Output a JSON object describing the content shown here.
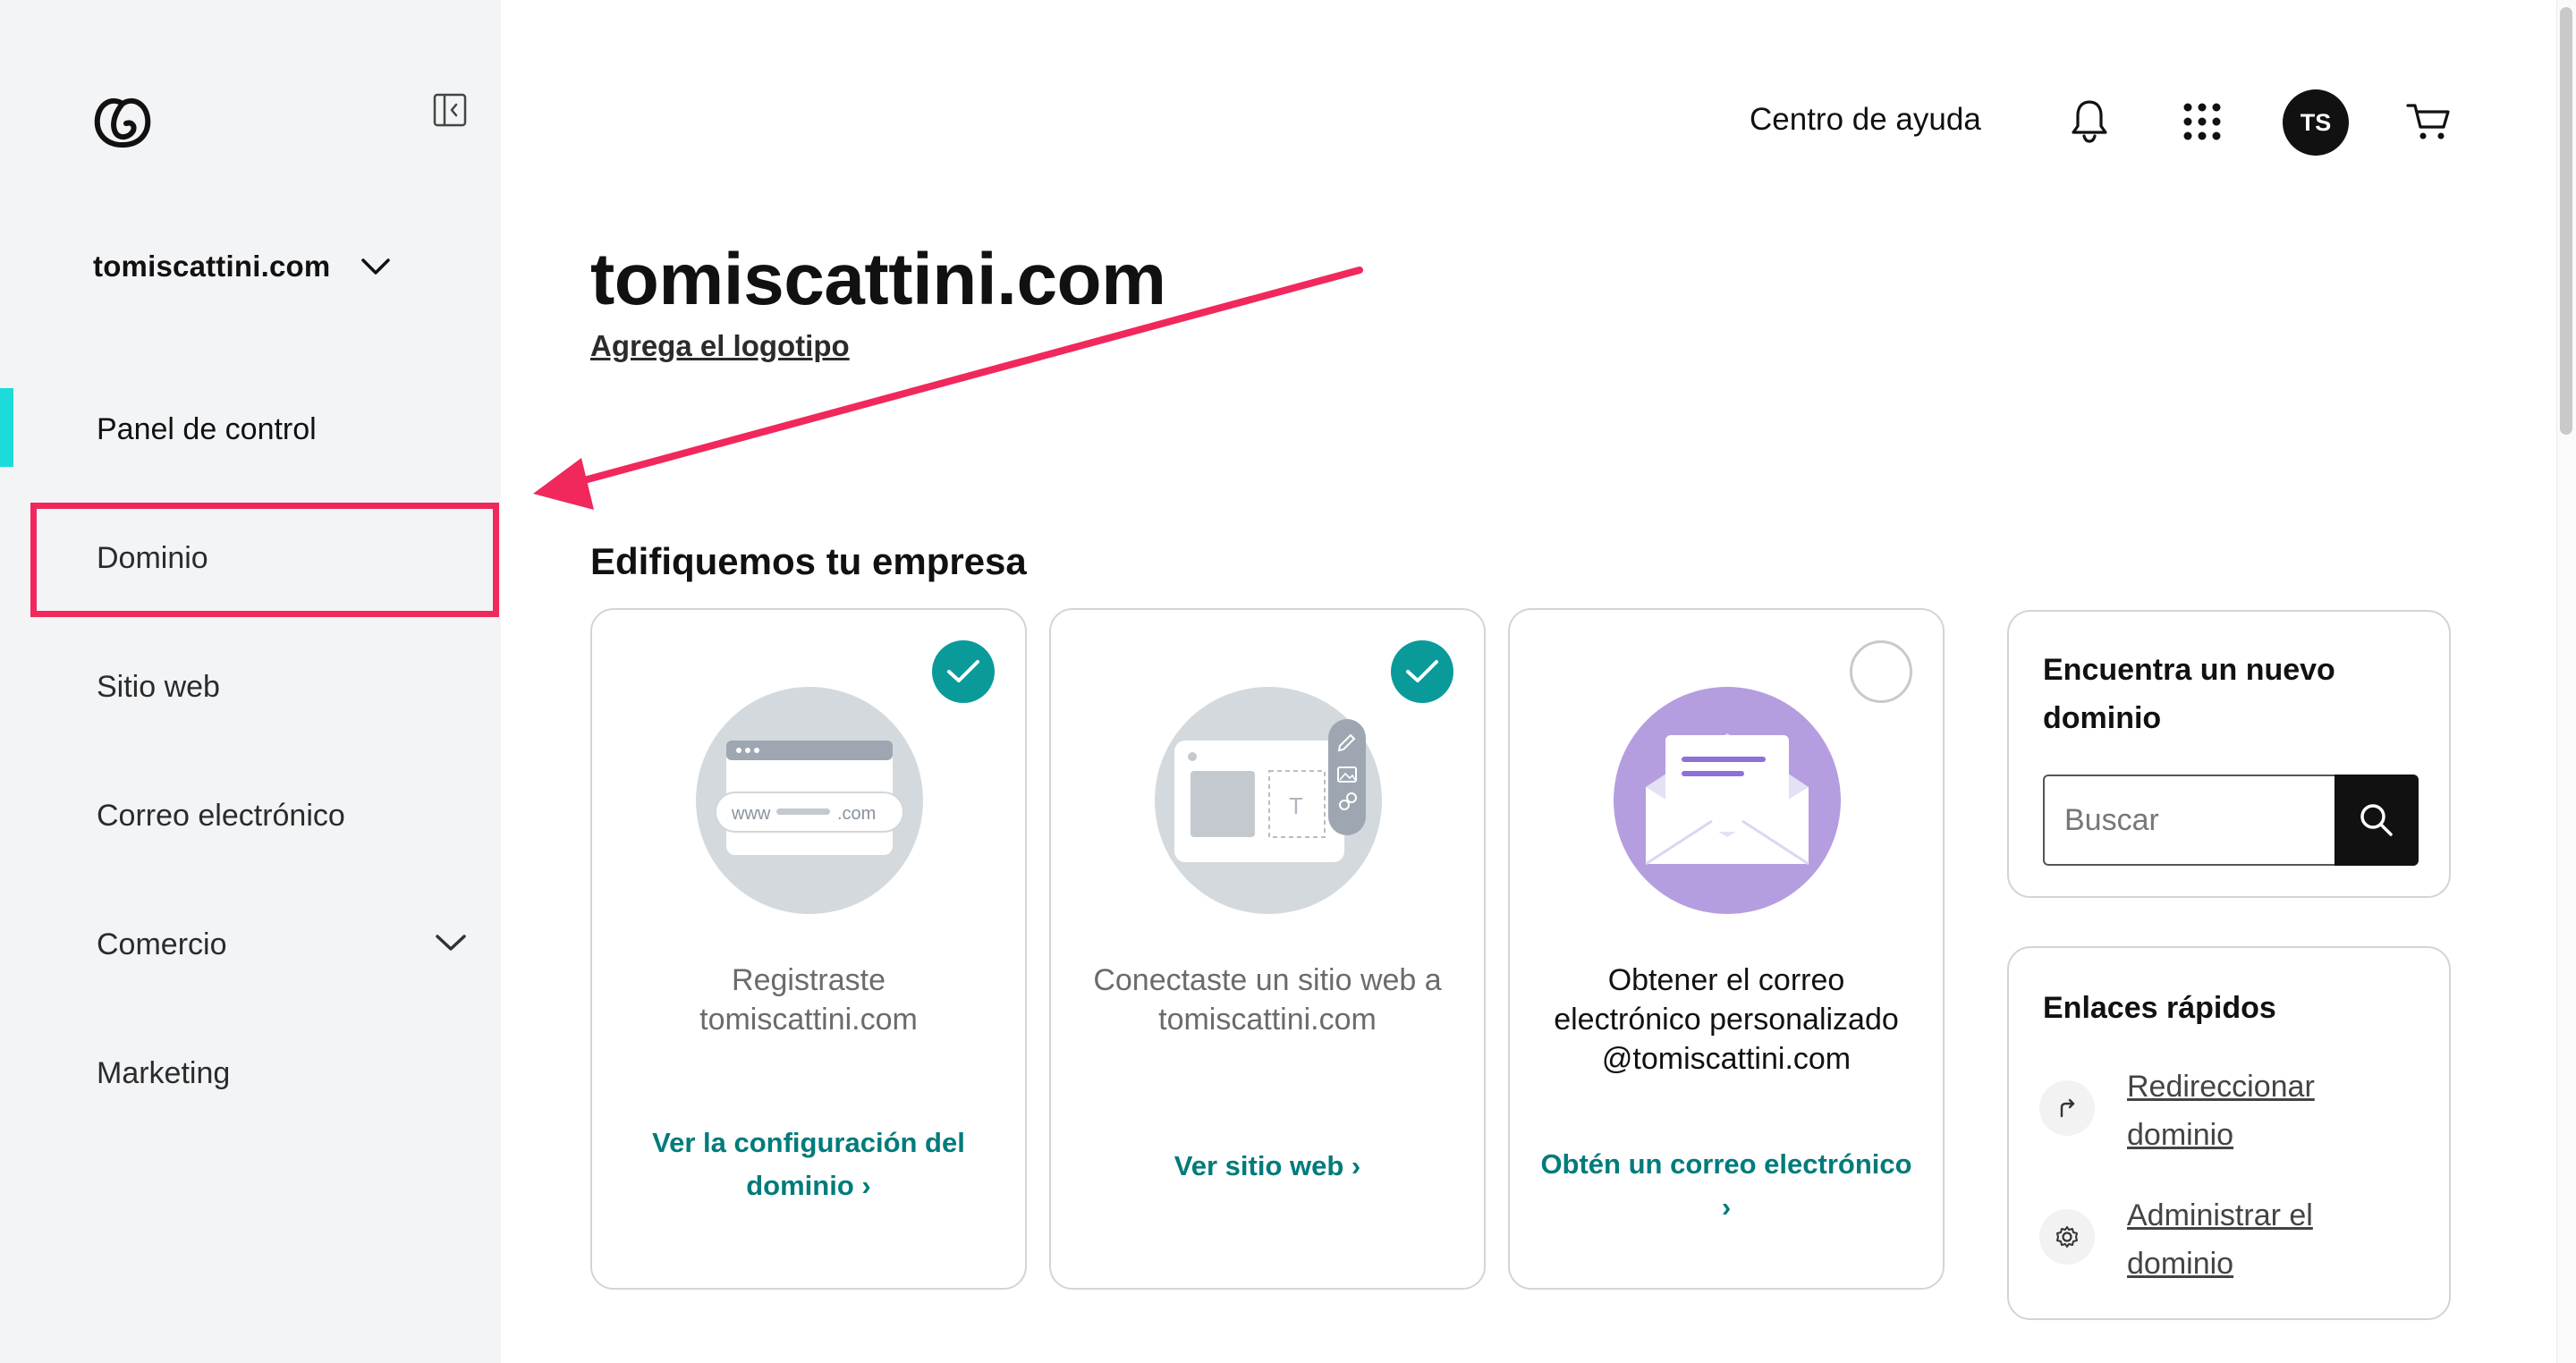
{
  "sidebar": {
    "domain_switch_label": "tomiscattini.com",
    "items": [
      {
        "label": "Panel de control"
      },
      {
        "label": "Dominio"
      },
      {
        "label": "Sitio web"
      },
      {
        "label": "Correo electrónico"
      },
      {
        "label": "Comercio"
      },
      {
        "label": "Marketing"
      }
    ]
  },
  "header": {
    "help_label": "Centro de ayuda",
    "avatar_initials": "TS"
  },
  "main": {
    "title": "tomiscattini.com",
    "add_logo_link": "Agrega el logotipo",
    "section_title": "Edifiquemos tu empresa",
    "cards": [
      {
        "text_line1": "Registraste",
        "text_line2": "tomiscattini.com",
        "link_line1": "Ver la configuración del",
        "link_line2": "dominio",
        "completed": true,
        "illustration_text": "www",
        "illustration_suffix": ".com"
      },
      {
        "text_line1": "Conectaste un sitio web a",
        "text_line2": "tomiscattini.com",
        "link_line1": "Ver sitio web",
        "completed": true,
        "illustration_text": "T"
      },
      {
        "text_line1": "Obtener el correo",
        "text_line2": "electrónico personalizado",
        "text_line3": "@tomiscattini.com",
        "link_line1": "Obtén un correo electrónico",
        "completed": false
      }
    ]
  },
  "find_domain": {
    "title_line1": "Encuentra un nuevo",
    "title_line2": "dominio",
    "search_placeholder": "Buscar"
  },
  "quick_links": {
    "title": "Enlaces rápidos",
    "items": [
      {
        "line1": "Redireccionar",
        "line2": "dominio",
        "icon": "redirect-arrow-icon"
      },
      {
        "line1": "Administrar el",
        "line2": "dominio",
        "icon": "gear-icon"
      }
    ]
  },
  "colors": {
    "accent_teal": "#0a9a9a",
    "link_teal": "#007b7b",
    "active_indicator": "#1bdbdb",
    "annotation_red": "#f0285c",
    "email_purple": "#b49ee0"
  }
}
